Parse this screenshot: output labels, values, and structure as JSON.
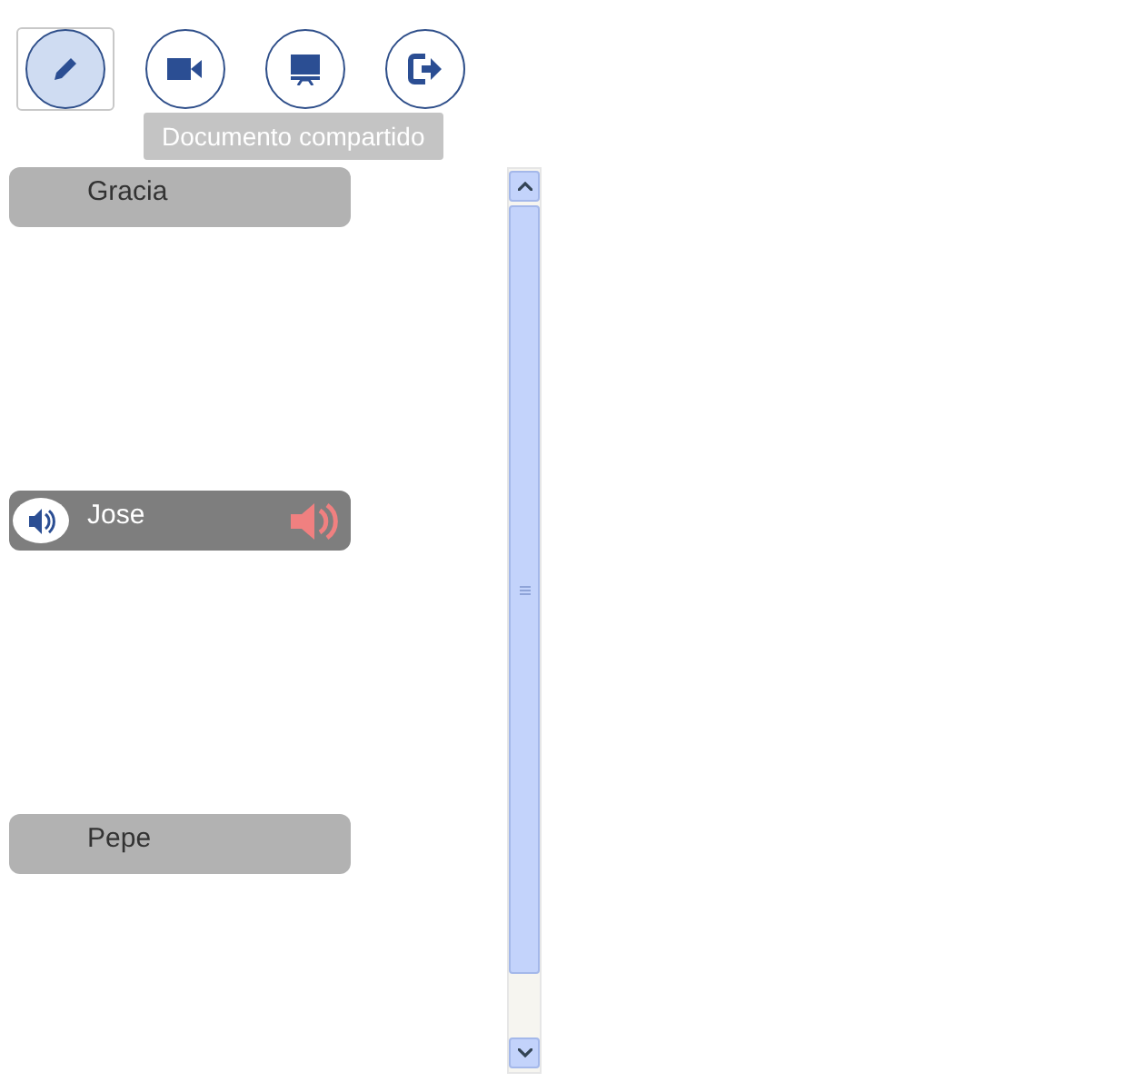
{
  "toolbar": [
    {
      "kind": "edit",
      "selected": true
    },
    {
      "kind": "video",
      "selected": false
    },
    {
      "kind": "screen",
      "selected": false
    },
    {
      "kind": "exit",
      "selected": false
    }
  ],
  "tooltip": "Documento compartido",
  "participants": [
    {
      "name": "Gracia",
      "speaking": false
    },
    {
      "name": "Jose",
      "speaking": true
    },
    {
      "name": "Pepe",
      "speaking": false
    }
  ]
}
